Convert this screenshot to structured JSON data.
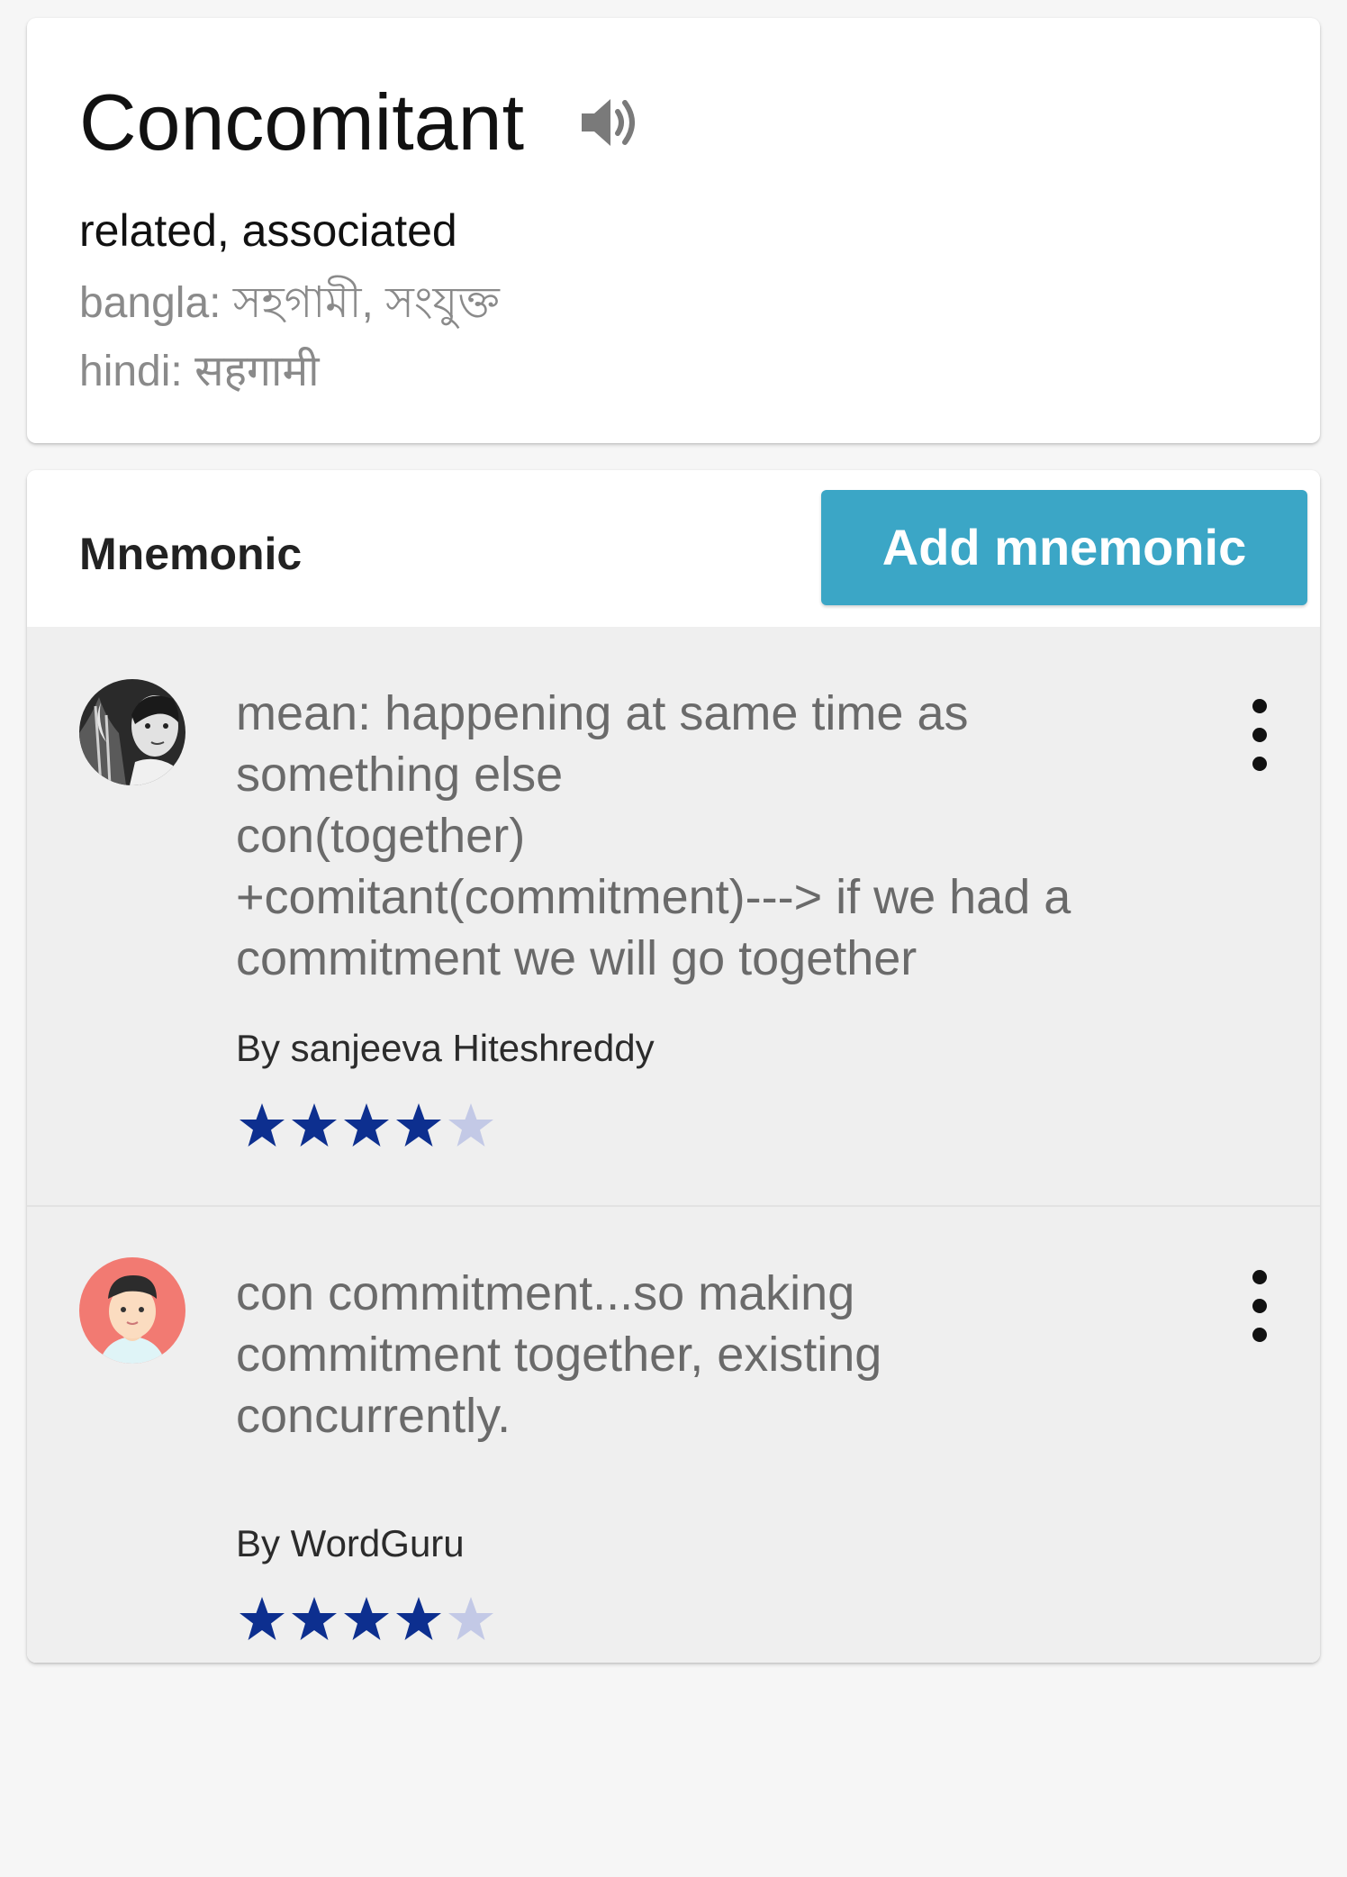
{
  "word": {
    "title": "Concomitant",
    "meaning": "related, associated",
    "bangla": "bangla: সহগামী, সংযুক্ত",
    "hindi": "hindi: सहगामी",
    "speaker_icon": "speaker-icon"
  },
  "mnemonic": {
    "label": "Mnemonic",
    "add_button": "Add mnemonic",
    "entries": [
      {
        "text": "mean: happening at same time as\nsomething else\ncon(together)\n+comitant(commitment)---> if we had a\ncommitment we will go together",
        "author": "By sanjeeva Hiteshreddy",
        "rating": 4,
        "rating_max": 5,
        "avatar_icon": "user-photo-avatar"
      },
      {
        "text": "con commitment...so making\ncommitment together, existing\nconcurrently.",
        "author": "By WordGuru",
        "rating": 4,
        "rating_max": 5,
        "avatar_icon": "cartoon-user-avatar"
      }
    ]
  },
  "colors": {
    "accent": "#3ba6c6",
    "star_filled": "#0d2f8f",
    "star_empty": "#c3c9e6",
    "muted_text": "#8a8a8a"
  }
}
